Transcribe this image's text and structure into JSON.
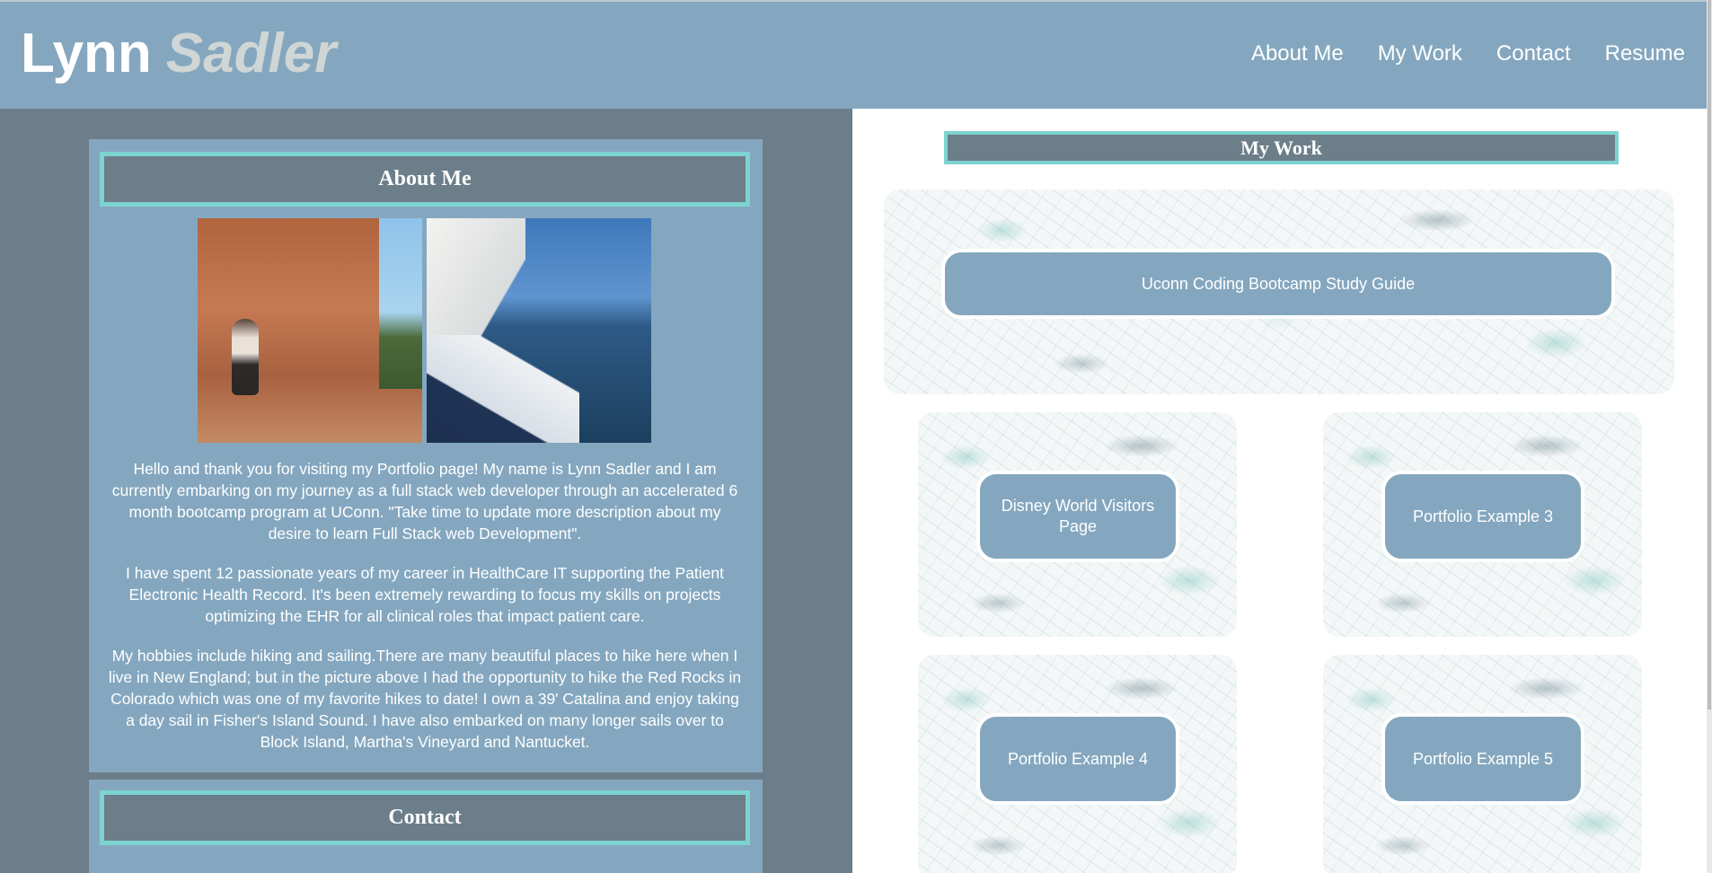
{
  "header": {
    "first_name": "Lynn",
    "last_name": "Sadler",
    "nav": [
      "About Me",
      "My Work",
      "Contact",
      "Resume"
    ]
  },
  "about": {
    "title": "About Me",
    "paragraphs": [
      "Hello and thank you for visiting my Portfolio page! My name is Lynn Sadler and I am currently embarking on my journey as a full stack web developer through an accelerated 6 month bootcamp program at UConn. \"Take time to update more description about my desire to learn Full Stack web Development\".",
      "I have spent 12 passionate years of my career in HealthCare IT supporting the Patient Electronic Health Record. It's been extremely rewarding to focus my skills on projects optimizing the EHR for all clinical roles that impact patient care.",
      "My hobbies include hiking and sailing.There are many beautiful places to hike here when I live in New England; but in the picture above I had the opportunity to hike the Red Rocks in Colorado which was one of my favorite hikes to date! I own a 39' Catalina and enjoy taking a day sail in Fisher's Island Sound. I have also embarked on many longer sails over to Block Island, Martha's Vineyard and Nantucket."
    ]
  },
  "contact": {
    "title": "Contact"
  },
  "work": {
    "title": "My Work",
    "featured": "Uconn Coding Bootcamp Study Guide",
    "projects": [
      "Disney World Visitors Page",
      "Portfolio Example 3",
      "Portfolio Example 4",
      "Portfolio Example 5"
    ]
  },
  "colors": {
    "header_bg": "#84a7bf",
    "page_bg": "#6c7e89",
    "accent_border": "#7cd3cf",
    "panel_bg": "#84a7bf"
  }
}
